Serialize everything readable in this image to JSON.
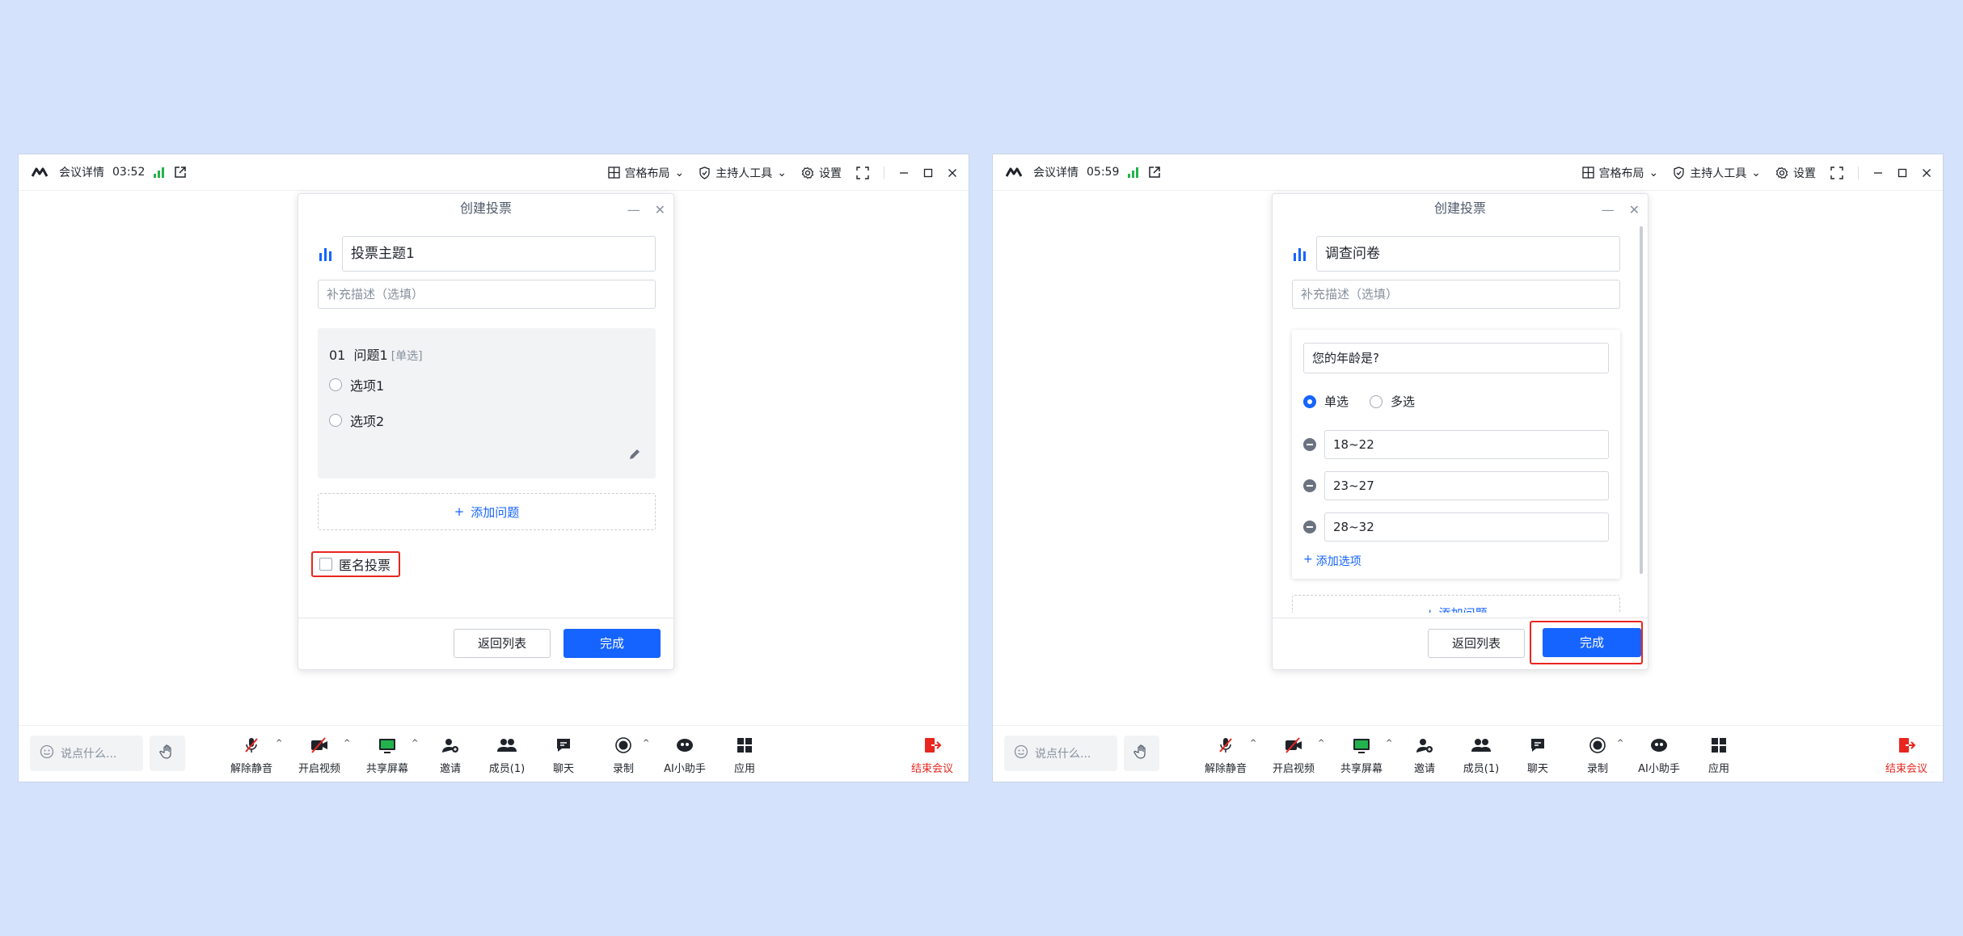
{
  "windows": [
    {
      "titlebar": {
        "meeting_info": "会议详情",
        "time": "03:52",
        "layout": "宫格布局",
        "host_tools": "主持人工具",
        "settings": "设置"
      },
      "dialog": {
        "title": "创建投票",
        "topic": "投票主题1",
        "desc_placeholder": "补充描述（选填）",
        "question": {
          "number": "01",
          "title": "问题1",
          "type_tag": "[单选]",
          "options": [
            "选项1",
            "选项2"
          ]
        },
        "add_question": "添加问题",
        "anonymous": "匿名投票",
        "back": "返回列表",
        "done": "完成"
      },
      "toolbar": {
        "say_placeholder": "说点什么...",
        "unmute": "解除静音",
        "video": "开启视频",
        "share": "共享屏幕",
        "invite": "邀请",
        "members": "成员(1)",
        "chat": "聊天",
        "record": "录制",
        "ai": "AI小助手",
        "apps": "应用",
        "end": "结束会议"
      }
    },
    {
      "titlebar": {
        "meeting_info": "会议详情",
        "time": "05:59",
        "layout": "宫格布局",
        "host_tools": "主持人工具",
        "settings": "设置"
      },
      "dialog": {
        "title": "创建投票",
        "topic": "调查问卷",
        "desc_placeholder": "补充描述（选填）",
        "question": {
          "title": "您的年龄是?",
          "single": "单选",
          "multi": "多选",
          "options": [
            "18~22",
            "23~27",
            "28~32"
          ],
          "add_option": "添加选项"
        },
        "add_question": "+ 添加问题",
        "back": "返回列表",
        "done": "完成"
      },
      "toolbar": {
        "say_placeholder": "说点什么...",
        "unmute": "解除静音",
        "video": "开启视频",
        "share": "共享屏幕",
        "invite": "邀请",
        "members": "成员(1)",
        "chat": "聊天",
        "record": "录制",
        "ai": "AI小助手",
        "apps": "应用",
        "end": "结束会议"
      }
    }
  ],
  "colors": {
    "background": "#d5e2fb",
    "accent": "#1664ff",
    "danger": "#e8261f"
  }
}
